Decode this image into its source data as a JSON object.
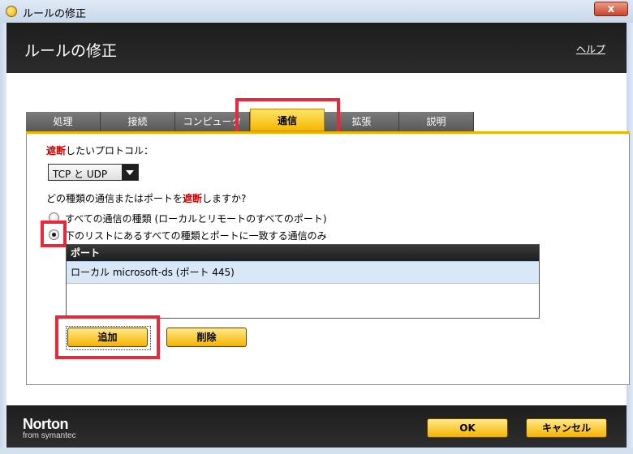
{
  "window": {
    "title": "ルールの修正",
    "close_label": "x"
  },
  "header": {
    "title": "ルールの修正",
    "help": "ヘルプ"
  },
  "tabs": [
    {
      "label": "処理"
    },
    {
      "label": "接続"
    },
    {
      "label": "コンピュータ"
    },
    {
      "label": "通信",
      "active": true
    },
    {
      "label": "拡張"
    },
    {
      "label": "説明"
    }
  ],
  "protocol": {
    "label_red": "遮断",
    "label_rest": "したいプロトコル：",
    "selected": "TCP と UDP"
  },
  "question": {
    "prefix": "どの種類の通信またはポートを",
    "red": "遮断",
    "suffix": "しますか?"
  },
  "options": [
    {
      "label": "すべての通信の種類 (ローカルとリモートのすべてのポート)",
      "checked": false
    },
    {
      "label": "下のリストにあるすべての種類とポートに一致する通信のみ",
      "checked": true
    }
  ],
  "port_table": {
    "header": "ポート",
    "rows": [
      "ローカル microsoft-ds (ポート 445)"
    ]
  },
  "buttons": {
    "add": "追加",
    "delete": "削除",
    "ok": "OK",
    "cancel": "キャンセル"
  },
  "brand": {
    "name": "Norton",
    "sub": "from symantec"
  },
  "colors": {
    "accent": "#f5b300",
    "highlight": "#e8293a",
    "header_bg": "#1d1d1d"
  }
}
